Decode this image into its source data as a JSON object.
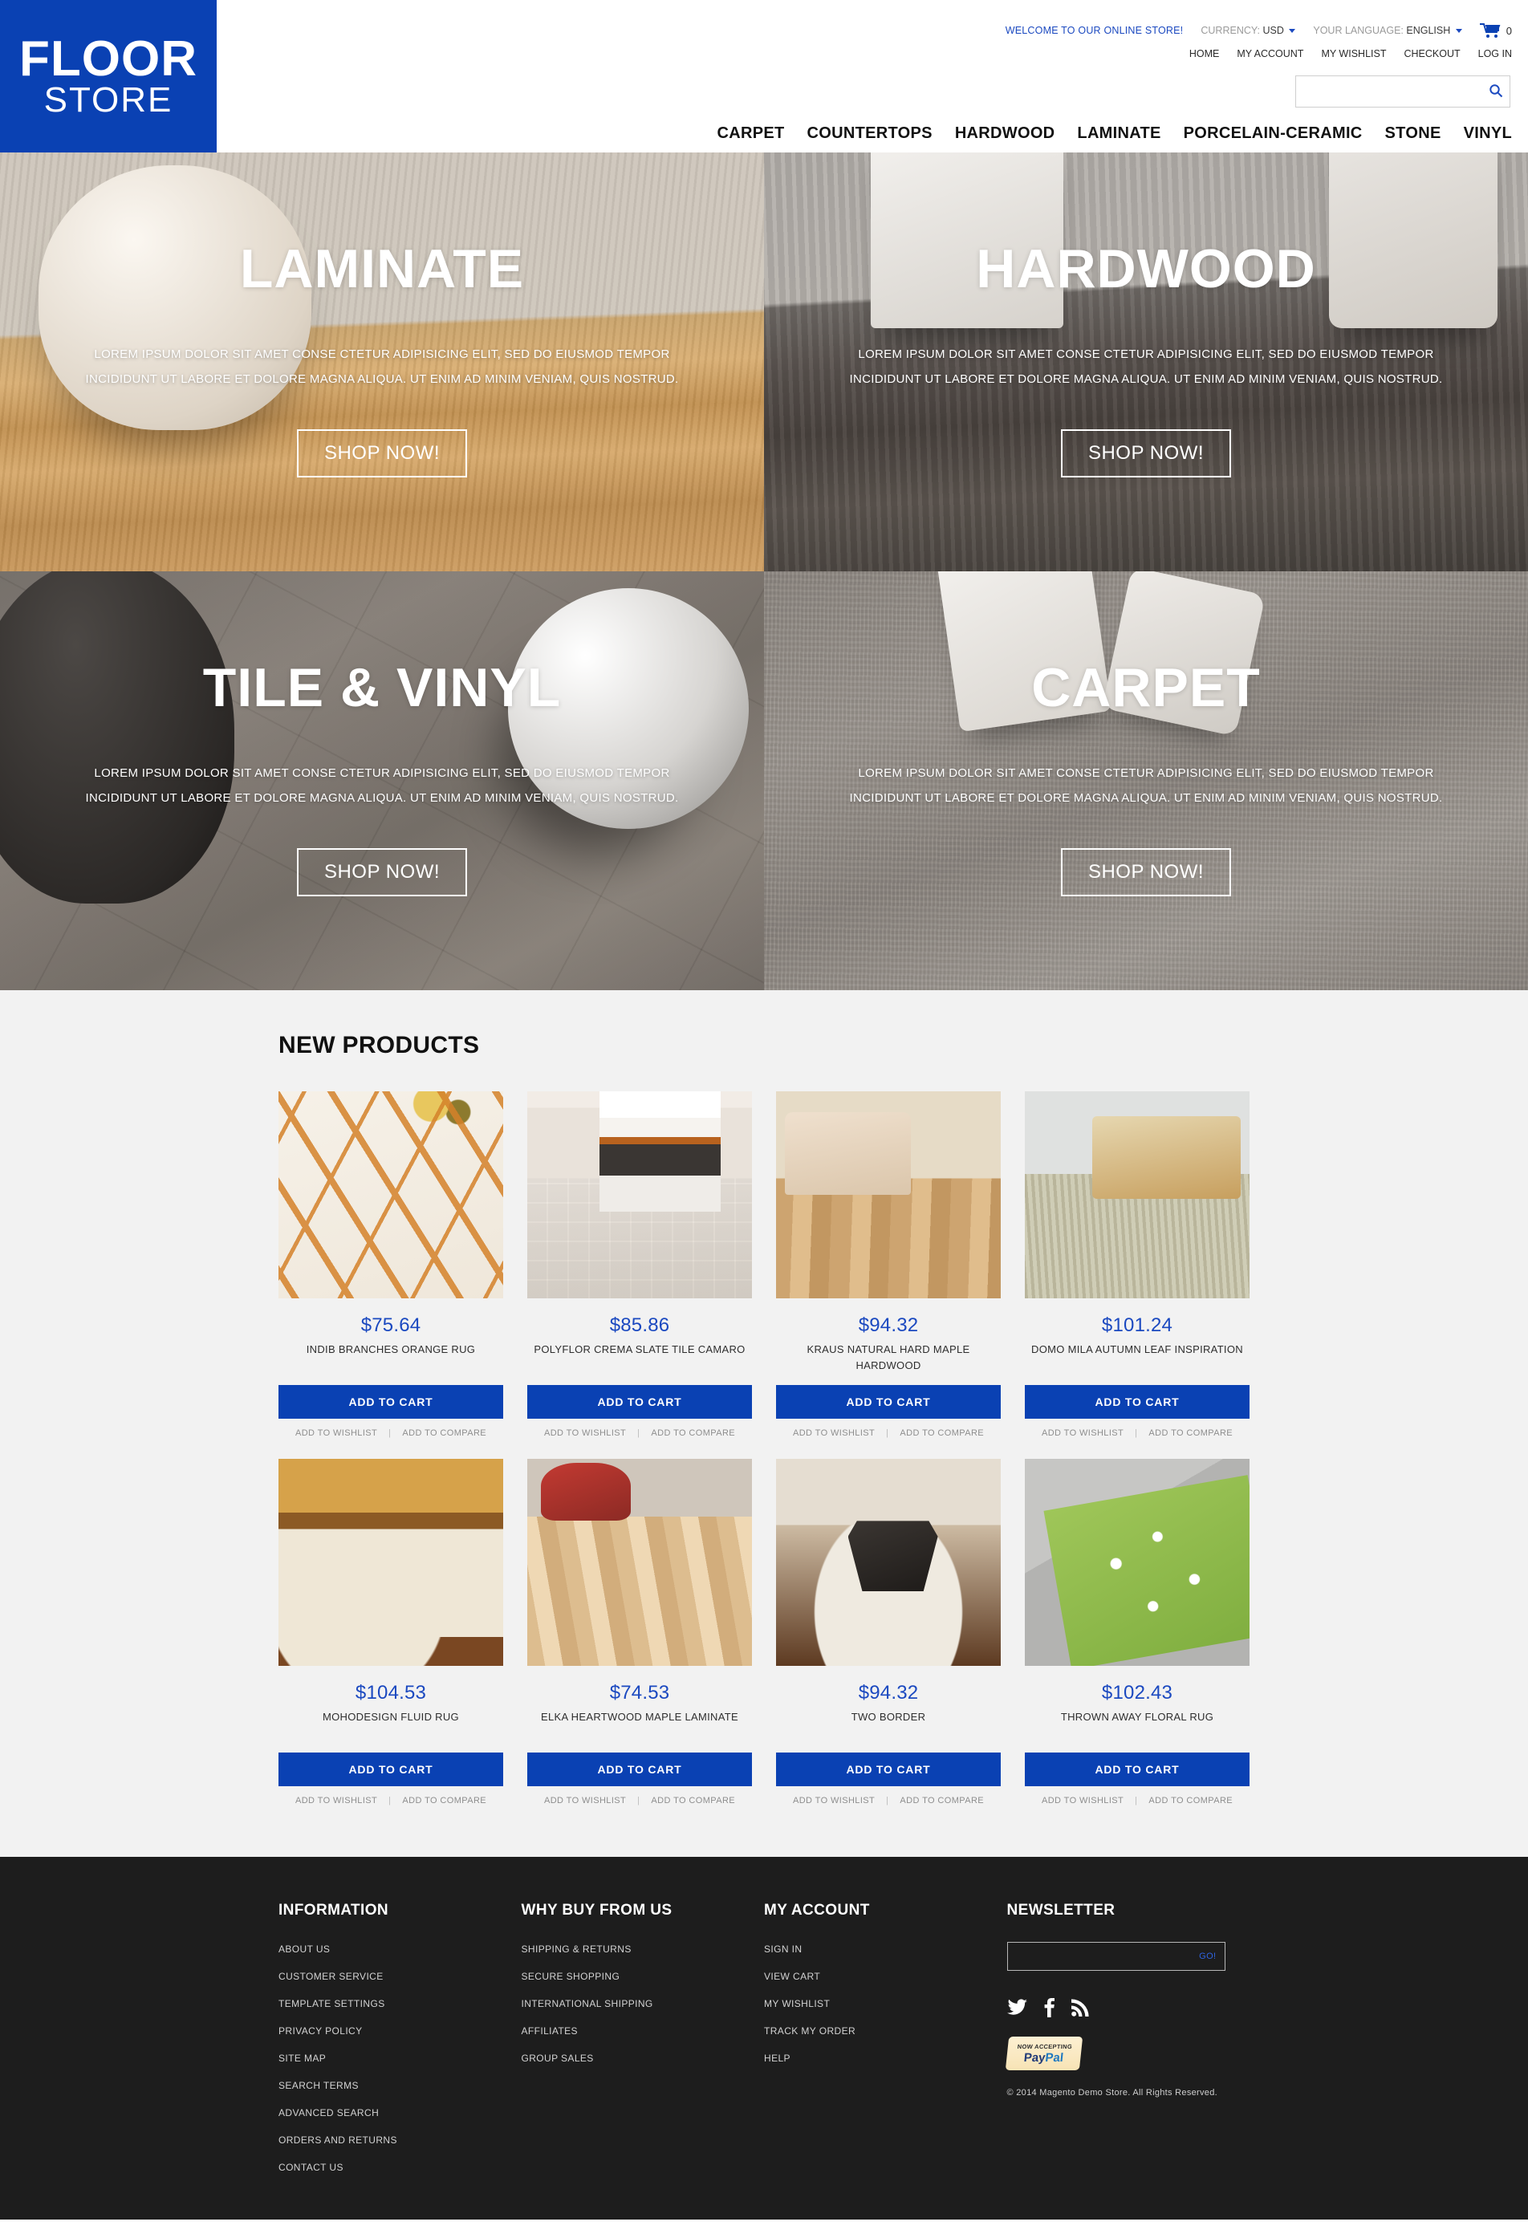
{
  "header": {
    "logo": {
      "line1": "FLOOR",
      "line2": "STORE",
      "bg_color": "#0a41b3"
    },
    "welcome": "WELCOME TO OUR ONLINE STORE!",
    "currency": {
      "label": "CURRENCY:",
      "value": "USD"
    },
    "language": {
      "label": "YOUR LANGUAGE:",
      "value": "ENGLISH"
    },
    "cart": {
      "icon": "cart-icon",
      "count": "0"
    },
    "account_links": [
      "HOME",
      "MY ACCOUNT",
      "MY WISHLIST",
      "CHECKOUT",
      "LOG IN"
    ],
    "search": {
      "value": "",
      "placeholder": "",
      "icon": "search-icon"
    },
    "nav": [
      "CARPET",
      "COUNTERTOPS",
      "HARDWOOD",
      "LAMINATE",
      "PORCELAIN-CERAMIC",
      "STONE",
      "VINYL"
    ]
  },
  "banners": [
    {
      "title": "LAMINATE",
      "desc": "LOREM IPSUM DOLOR SIT AMET CONSE CTETUR ADIPISICING ELIT, SED DO EIUSMOD TEMPOR INCIDIDUNT UT LABORE ET DOLORE MAGNA ALIQUA. UT ENIM AD MINIM VENIAM, QUIS NOSTRUD.",
      "button": "SHOP NOW!",
      "bg_class": "bg-laminate"
    },
    {
      "title": "HARDWOOD",
      "desc": "LOREM IPSUM DOLOR SIT AMET CONSE CTETUR ADIPISICING ELIT, SED DO EIUSMOD TEMPOR INCIDIDUNT UT LABORE ET DOLORE MAGNA ALIQUA. UT ENIM AD MINIM VENIAM, QUIS NOSTRUD.",
      "button": "SHOP NOW!",
      "bg_class": "bg-hardwood"
    },
    {
      "title": "TILE & VINYL",
      "desc": "LOREM IPSUM DOLOR SIT AMET CONSE CTETUR ADIPISICING ELIT, SED DO EIUSMOD TEMPOR INCIDIDUNT UT LABORE ET DOLORE MAGNA ALIQUA. UT ENIM AD MINIM VENIAM, QUIS NOSTRUD.",
      "button": "SHOP NOW!",
      "bg_class": "bg-tile"
    },
    {
      "title": "CARPET",
      "desc": "LOREM IPSUM DOLOR SIT AMET CONSE CTETUR ADIPISICING ELIT, SED DO EIUSMOD TEMPOR INCIDIDUNT UT LABORE ET DOLORE MAGNA ALIQUA. UT ENIM AD MINIM VENIAM, QUIS NOSTRUD.",
      "button": "SHOP NOW!",
      "bg_class": "bg-carpet"
    }
  ],
  "products_section": {
    "title": "NEW PRODUCTS",
    "add_to_cart_label": "ADD TO CART",
    "wishlist_label": "ADD TO WISHLIST",
    "compare_label": "ADD TO COMPARE",
    "separator": "|",
    "accent_color": "#0a41b3",
    "items": [
      {
        "price": "$75.64",
        "name": "INDIB BRANCHES ORANGE RUG",
        "image_class": "p-indib"
      },
      {
        "price": "$85.86",
        "name": "POLYFLOR CREMA SLATE TILE CAMARO",
        "image_class": "p-polyflor"
      },
      {
        "price": "$94.32",
        "name": "KRAUS NATURAL HARD MAPLE HARDWOOD",
        "image_class": "p-kraus"
      },
      {
        "price": "$101.24",
        "name": "DOMO MILA AUTUMN LEAF INSPIRATION",
        "image_class": "p-domo"
      },
      {
        "price": "$104.53",
        "name": "MOHODESIGN FLUID RUG",
        "image_class": "p-moho"
      },
      {
        "price": "$74.53",
        "name": "ELKA HEARTWOOD MAPLE LAMINATE",
        "image_class": "p-elka"
      },
      {
        "price": "$94.32",
        "name": "TWO BORDER",
        "image_class": "p-two"
      },
      {
        "price": "$102.43",
        "name": "THROWN AWAY FLORAL RUG",
        "image_class": "p-thrown"
      }
    ]
  },
  "footer": {
    "columns": [
      {
        "heading": "INFORMATION",
        "links": [
          "ABOUT US",
          "CUSTOMER SERVICE",
          "TEMPLATE SETTINGS",
          "PRIVACY POLICY",
          "SITE MAP",
          "SEARCH TERMS",
          "ADVANCED SEARCH",
          "ORDERS AND RETURNS",
          "CONTACT US"
        ]
      },
      {
        "heading": "WHY BUY FROM US",
        "links": [
          "SHIPPING & RETURNS",
          "SECURE SHOPPING",
          "INTERNATIONAL SHIPPING",
          "AFFILIATES",
          "GROUP SALES"
        ]
      },
      {
        "heading": "MY ACCOUNT",
        "links": [
          "SIGN IN",
          "VIEW CART",
          "MY WISHLIST",
          "TRACK MY ORDER",
          "HELP"
        ]
      }
    ],
    "newsletter": {
      "heading": "NEWSLETTER",
      "value": "",
      "placeholder": "",
      "go_label": "GO!"
    },
    "socials": [
      "twitter-icon",
      "facebook-icon",
      "rss-icon"
    ],
    "paypal": {
      "top": "NOW ACCEPTING",
      "pay": "Pay",
      "pal": "Pal",
      "tm": "™"
    },
    "copyright": "© 2014 Magento Demo Store. All Rights Reserved."
  }
}
